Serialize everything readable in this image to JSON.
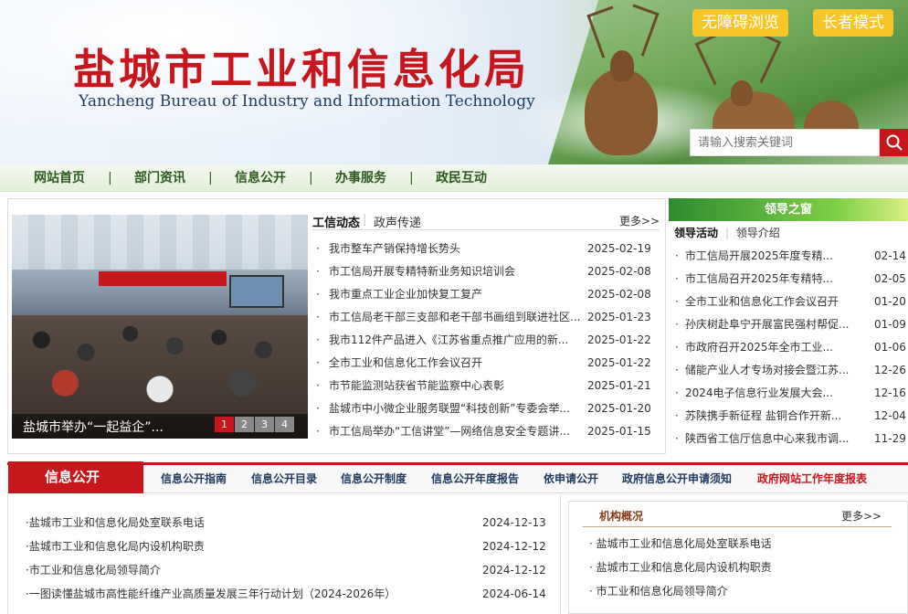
{
  "header": {
    "title": "盐城市工业和信息化局",
    "subtitle": "Yancheng Bureau of Industry and Information Technology",
    "accessibility_button": "无障碍浏览",
    "elder_button": "长者模式",
    "search_placeholder": "请输入搜索关键词"
  },
  "nav": [
    "网站首页",
    "部门资讯",
    "信息公开",
    "办事服务",
    "政民互动"
  ],
  "featured": {
    "caption": "盐城市举办“一起益企”...",
    "pages": [
      "1",
      "2",
      "3",
      "4"
    ]
  },
  "news": {
    "tabs": [
      "工信动态",
      "政声传递"
    ],
    "more": "更多>>",
    "items": [
      {
        "title": "我市整车产销保持增长势头",
        "date": "2025-02-19"
      },
      {
        "title": "市工信局开展专精特新业务知识培训会",
        "date": "2025-02-08"
      },
      {
        "title": "我市重点工业企业加快复工复产",
        "date": "2025-02-08"
      },
      {
        "title": "市工信局老干部三支部和老干部书画组到联进社区...",
        "date": "2025-01-23"
      },
      {
        "title": "我市112件产品进入《江苏省重点推广应用的新...",
        "date": "2025-01-22"
      },
      {
        "title": "全市工业和信息化工作会议召开",
        "date": "2025-01-22"
      },
      {
        "title": "市节能监测站获省节能监察中心表彰",
        "date": "2025-01-21"
      },
      {
        "title": "盐城市中小微企业服务联盟“科技创新”专委会举...",
        "date": "2025-01-20"
      },
      {
        "title": "市工信局举办“工信讲堂”—网络信息安全专题讲...",
        "date": "2025-01-15"
      }
    ]
  },
  "leader": {
    "title": "领导之窗",
    "tabs": [
      "领导活动",
      "领导介绍"
    ],
    "items": [
      {
        "title": "市工信局开展2025年度专精...",
        "date": "02-14"
      },
      {
        "title": "市工信局召开2025年专精特...",
        "date": "02-05"
      },
      {
        "title": "全市工业和信息化工作会议召开",
        "date": "01-20"
      },
      {
        "title": "孙庆树赴阜宁开展富民强村帮促...",
        "date": "01-09"
      },
      {
        "title": "市政府召开2025年全市工业...",
        "date": "01-06"
      },
      {
        "title": "储能产业人才专场对接会暨江苏...",
        "date": "12-26"
      },
      {
        "title": "2024电子信息行业发展大会...",
        "date": "12-16"
      },
      {
        "title": "苏陕携手新征程 盐铜合作开新...",
        "date": "12-04"
      },
      {
        "title": "陕西省工信厅信息中心来我市调...",
        "date": "11-29"
      }
    ]
  },
  "info": {
    "title": "信息公开",
    "links": [
      "信息公开指南",
      "信息公开目录",
      "信息公开制度",
      "信息公开年度报告",
      "依申请公开",
      "政府信息公开申请须知",
      "政府网站工作年度报表"
    ],
    "items": [
      {
        "title": "·盐城市工业和信息化局处室联系电话",
        "date": "2024-12-13"
      },
      {
        "title": "·盐城市工业和信息化局内设机构职责",
        "date": "2024-12-12"
      },
      {
        "title": "·市工业和信息化局领导简介",
        "date": "2024-12-12"
      },
      {
        "title": "·一图读懂盐城市高性能纤维产业高质量发展三年行动计划（2024-2026年）",
        "date": "2024-06-14"
      }
    ]
  },
  "org": {
    "title": "机构概况",
    "more": "更多>>",
    "items": [
      "盐城市工业和信息化局处室联系电话",
      "盐城市工业和信息化局内设机构职责",
      "市工业和信息化局领导简介"
    ]
  },
  "colors": {
    "brand_red": "#c8161d",
    "nav_green": "#2d5a1f",
    "leader_green": "#2e8b32",
    "button_yellow": "#f7c526"
  }
}
